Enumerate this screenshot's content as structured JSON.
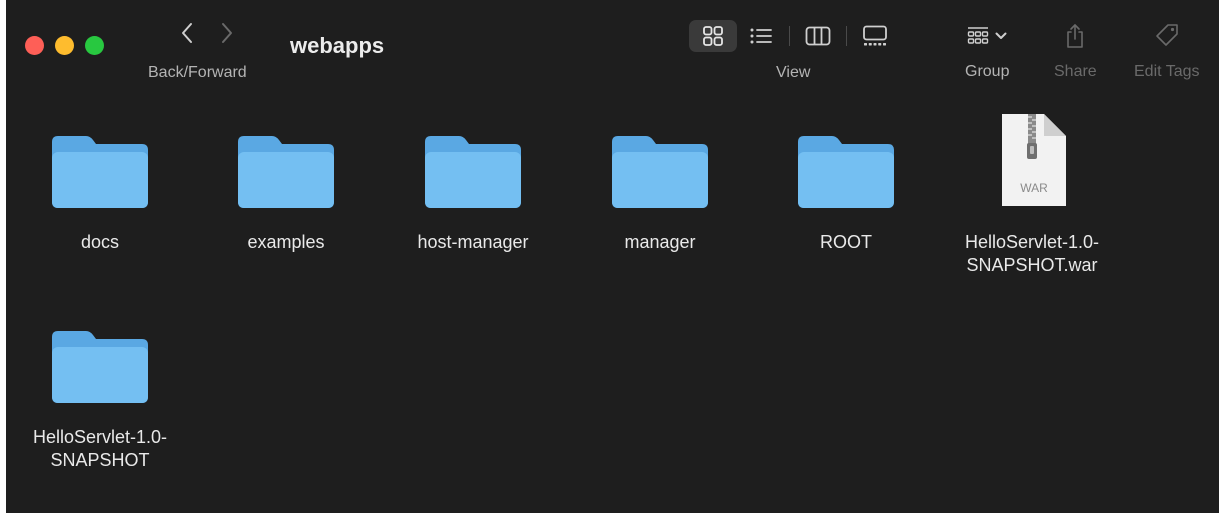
{
  "window": {
    "title": "webapps"
  },
  "toolbar": {
    "nav_caption": "Back/Forward",
    "view_caption": "View",
    "view_modes": [
      "icons-view",
      "list-view",
      "columns-view",
      "gallery-view"
    ],
    "active_view": "icons-view",
    "group_caption": "Group",
    "share_caption": "Share",
    "tags_caption": "Edit Tags"
  },
  "files": {
    "items": [
      {
        "label": "docs",
        "kind": "folder-icon"
      },
      {
        "label": "examples",
        "kind": "folder-icon"
      },
      {
        "label": "host-manager",
        "kind": "folder-icon"
      },
      {
        "label": "manager",
        "kind": "folder-icon"
      },
      {
        "label": "ROOT",
        "kind": "folder-icon"
      },
      {
        "label": "HelloServlet-1.0-SNAPSHOT.war",
        "line1": "HelloServlet-1.0-",
        "line2": "SNAPSHOT.war",
        "kind": "war-archive-icon",
        "badge": "WAR"
      },
      {
        "label": "HelloServlet-1.0-SNAPSHOT",
        "line1": "HelloServlet-1.0-",
        "line2": "SNAPSHOT",
        "kind": "folder-icon"
      }
    ]
  },
  "colors": {
    "window_bg": "#1e1e1e",
    "folder_front": "#74bff2",
    "folder_back": "#5aa8e3",
    "close": "#fe5f57",
    "minimize": "#febc2e",
    "zoom": "#28c840"
  }
}
